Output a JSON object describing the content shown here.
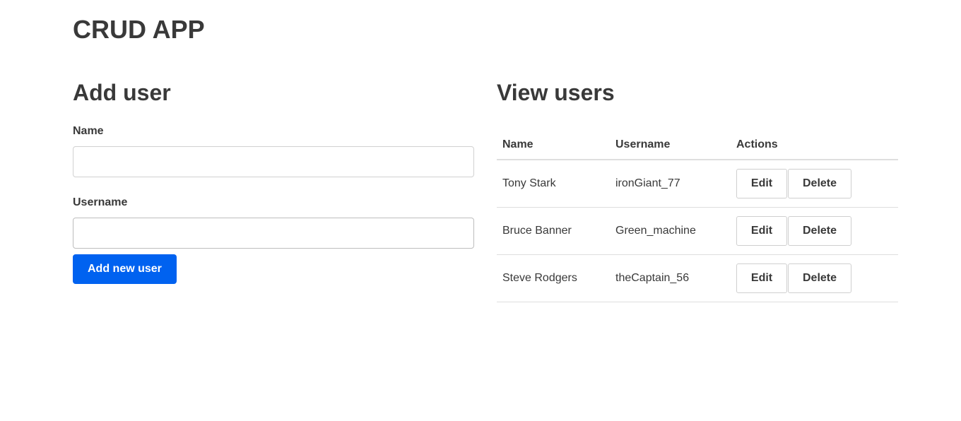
{
  "app": {
    "title": "CRUD APP"
  },
  "add_user": {
    "heading": "Add user",
    "name_label": "Name",
    "name_value": "",
    "username_label": "Username",
    "username_value": "",
    "submit_label": "Add new user"
  },
  "view_users": {
    "heading": "View users",
    "columns": [
      "Name",
      "Username",
      "Actions"
    ],
    "rows": [
      {
        "name": "Tony Stark",
        "username": "ironGiant_77",
        "edit_label": "Edit",
        "delete_label": "Delete"
      },
      {
        "name": "Bruce Banner",
        "username": "Green_machine",
        "edit_label": "Edit",
        "delete_label": "Delete"
      },
      {
        "name": "Steve Rodgers",
        "username": "theCaptain_56",
        "edit_label": "Edit",
        "delete_label": "Delete"
      }
    ]
  },
  "colors": {
    "accent": "#0062f0",
    "text": "#393939",
    "border": "#dedede"
  }
}
